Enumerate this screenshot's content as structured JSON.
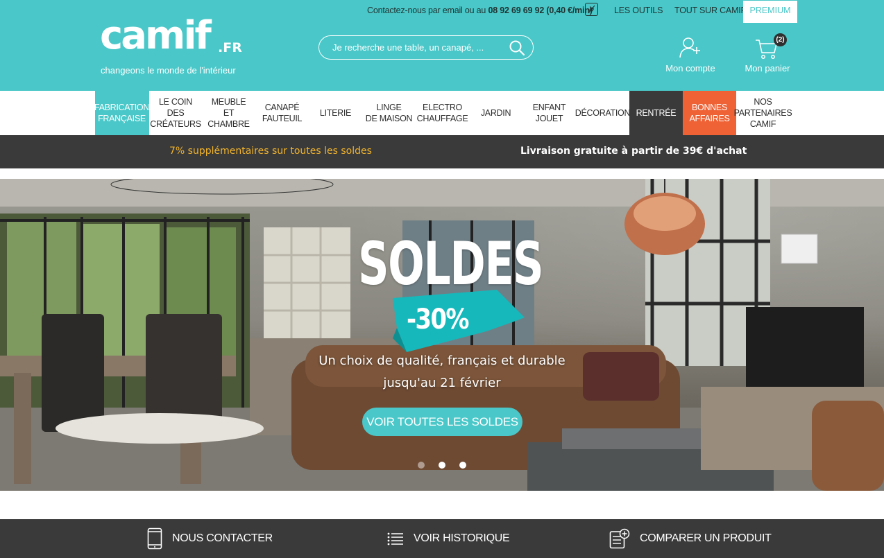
{
  "topbar": {
    "contact_prefix": "Contactez-nous par email ou au ",
    "phone": "08 92 69 69 92 (0,40 €/min)",
    "links": [
      "LES OUTILS",
      "TOUT SUR CAMIF"
    ],
    "premium": "PREMIUM"
  },
  "logo": {
    "word": "camif",
    "suffix": ".FR",
    "tagline": "changeons le monde de l'intérieur"
  },
  "search": {
    "placeholder": "Je recherche une table, un canapé, ..."
  },
  "account": {
    "label": "Mon compte",
    "icon": "user-plus-icon"
  },
  "cart": {
    "label": "Mon panier",
    "count": "(2)",
    "icon": "cart-icon"
  },
  "nav": {
    "items": [
      {
        "lines": [
          "FABRICATION",
          "FRANÇAISE"
        ],
        "style": "active"
      },
      {
        "lines": [
          "LE COIN DES",
          "CRÉATEURS"
        ],
        "style": "bordered"
      },
      {
        "lines": [
          "MEUBLE",
          "ET",
          "CHAMBRE"
        ],
        "style": ""
      },
      {
        "lines": [
          "CANAPÉ",
          "FAUTEUIL"
        ],
        "style": ""
      },
      {
        "lines": [
          "LITERIE"
        ],
        "style": ""
      },
      {
        "lines": [
          "LINGE",
          "DE MAISON"
        ],
        "style": ""
      },
      {
        "lines": [
          "ELECTRO",
          "CHAUFFAGE"
        ],
        "style": ""
      },
      {
        "lines": [
          "JARDIN"
        ],
        "style": ""
      },
      {
        "lines": [
          "ENFANT",
          "JOUET"
        ],
        "style": ""
      },
      {
        "lines": [
          "DÉCORATION"
        ],
        "style": ""
      },
      {
        "lines": [
          "RENTRÉE"
        ],
        "style": "dark"
      },
      {
        "lines": [
          "BONNES",
          "AFFAIRES"
        ],
        "style": "orange"
      },
      {
        "lines": [
          "NOS",
          "PARTENAIRES",
          "CAMIF"
        ],
        "style": ""
      }
    ]
  },
  "promo": {
    "left": "7% supplémentaires sur toutes les soldes",
    "right": "Livraison gratuite à partir de 39€ d'achat"
  },
  "hero": {
    "title": "SOLDES",
    "badge": "-30%",
    "subtitle_line1": "Un choix de qualité, français et durable",
    "subtitle_line2": "jusqu'au 21 février",
    "cta": "VOIR TOUTES LES SOLDES",
    "slides": 3,
    "active_slide": 2
  },
  "footer_bar": {
    "items": [
      {
        "label": "NOUS CONTACTER",
        "icon": "phone-device-icon"
      },
      {
        "label": "VOIR HISTORIQUE",
        "icon": "list-icon"
      },
      {
        "label": "COMPARER UN PRODUIT",
        "icon": "compare-document-icon"
      }
    ]
  },
  "colors": {
    "brand": "#4ac7c8",
    "dark": "#3a3a3a",
    "orange": "#ee6235",
    "promo_yellow": "#f0b32d"
  }
}
